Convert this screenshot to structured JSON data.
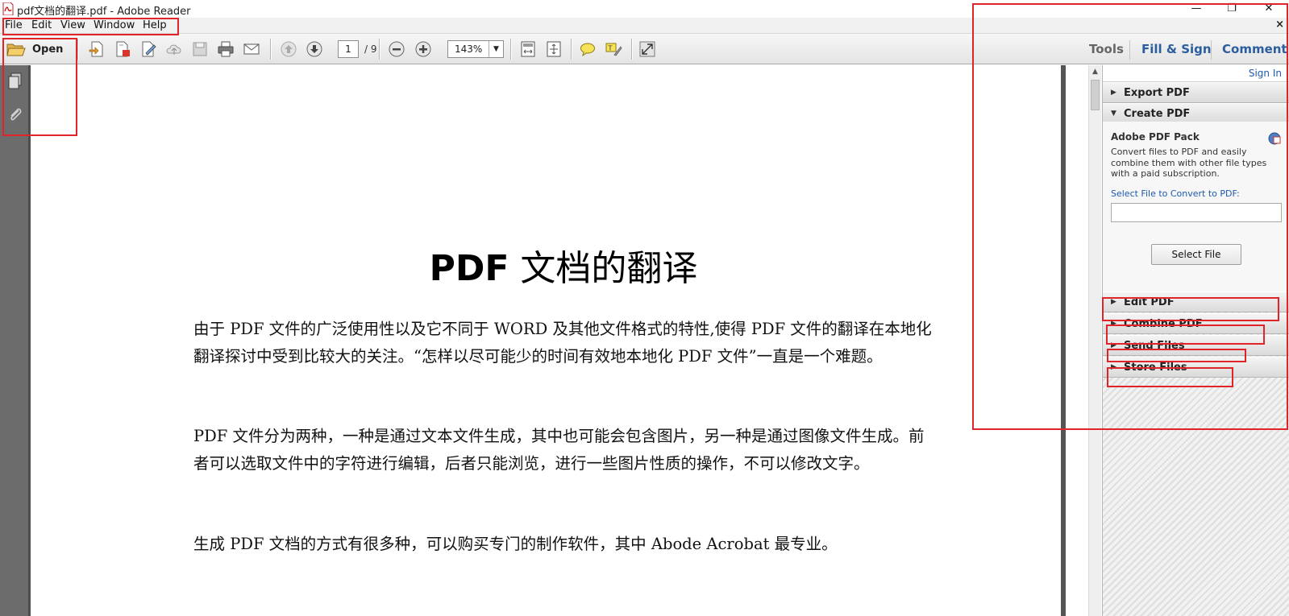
{
  "window": {
    "title": "pdf文档的翻译.pdf - Adobe Reader",
    "minimize_glyph": "—",
    "restore_glyph": "❐",
    "close_glyph": "✕"
  },
  "menu": {
    "items": [
      "File",
      "Edit",
      "View",
      "Window",
      "Help"
    ],
    "close_glyph": "×"
  },
  "toolbar": {
    "open_label": "Open",
    "page_current": "1",
    "page_total": "/ 9",
    "zoom": "143%",
    "tabs": [
      "Tools",
      "Fill & Sign",
      "Comment"
    ],
    "accent_color": "#2b5e9e"
  },
  "document": {
    "title_latin": "PDF",
    "title_cjk": "文档的翻译",
    "paragraphs": [
      "由于 PDF 文件的广泛使用性以及它不同于 WORD 及其他文件格式的特性,使得 PDF 文件的翻译在本地化翻译探讨中受到比较大的关注。“怎样以尽可能少的时间有效地本地化 PDF 文件”一直是一个难题。",
      "PDF 文件分为两种，一种是通过文本文件生成，其中也可能会包含图片，另一种是通过图像文件生成。前者可以选取文件中的字符进行编辑，后者只能浏览，进行一些图片性质的操作，不可以修改文字。",
      "生成 PDF 文档的方式有很多种，可以购买专门的制作软件，其中 Abode Acrobat 最专业。"
    ]
  },
  "right_pane": {
    "sign_in": "Sign In",
    "sections": {
      "export_pdf": "Export PDF",
      "create_pdf": "Create PDF",
      "edit_pdf": "Edit PDF",
      "combine_pdf": "Combine PDF",
      "send_files": "Send Files",
      "store_files": "Store Files"
    },
    "create": {
      "pack_title": "Adobe PDF Pack",
      "description": "Convert files to PDF and easily combine them with other file types with a paid subscription.",
      "select_label": "Select File to Convert to PDF:",
      "file_value": "",
      "select_button": "Select File"
    }
  },
  "annotation_color": "#e0242a"
}
